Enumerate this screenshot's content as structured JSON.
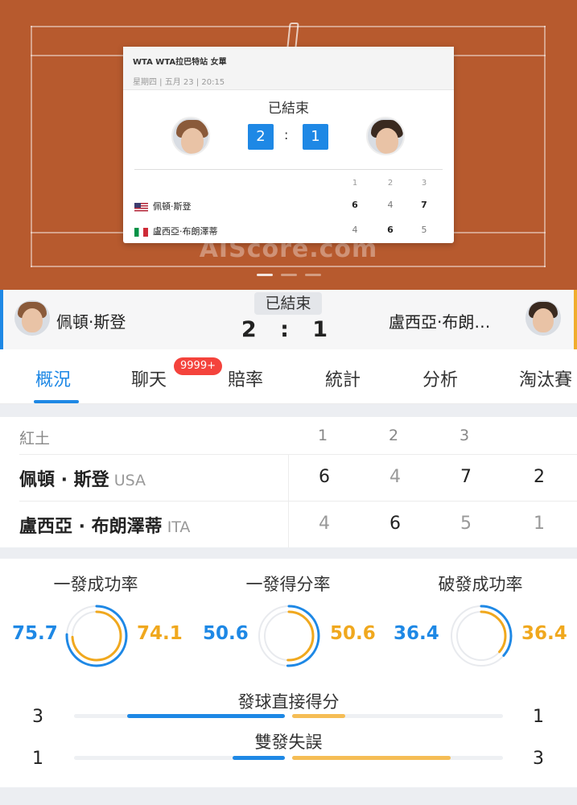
{
  "colors": {
    "accent": "#1e88e5",
    "player2": "#f0a81e",
    "court": "#b75a2e"
  },
  "header": {
    "watermark": "AIScore.com",
    "card": {
      "tournament": "WTA WTA拉巴特站 女單",
      "datetime": "星期四 | 五月 23 | 20:15",
      "status": "已結束",
      "score_home": "2",
      "score_away": "1",
      "colon": ":",
      "set_labels": [
        "1",
        "2",
        "3"
      ],
      "players": [
        {
          "name": "佩頓·斯登",
          "flag": "us-flag-icon",
          "sets": [
            "6",
            "4",
            "7"
          ]
        },
        {
          "name": "盧西亞·布朗澤蒂",
          "flag": "italy-flag-icon",
          "sets": [
            "4",
            "6",
            "5"
          ]
        }
      ]
    }
  },
  "match": {
    "home_name": "佩頓·斯登",
    "away_name": "盧西亞·布朗…",
    "status": "已結束",
    "score": "2 : 1"
  },
  "tabs": [
    {
      "label": "概況",
      "active": true
    },
    {
      "label": "聊天",
      "badge": "9999+"
    },
    {
      "label": "賠率"
    },
    {
      "label": "統計"
    },
    {
      "label": "分析"
    },
    {
      "label": "淘汰賽"
    }
  ],
  "scoretable": {
    "surface": "紅土",
    "set_headers": [
      "1",
      "2",
      "3"
    ],
    "rows": [
      {
        "name": "佩頓 · 斯登",
        "country": "USA",
        "sets": [
          "6",
          "4",
          "7"
        ],
        "total": "2"
      },
      {
        "name": "盧西亞 · 布朗澤蒂",
        "country": "ITA",
        "sets": [
          "4",
          "6",
          "5"
        ],
        "total": "1"
      }
    ]
  },
  "stats": {
    "donuts": [
      {
        "title": "一發成功率",
        "home": "75.7",
        "away": "74.1",
        "home_pct": 75.7,
        "away_pct": 74.1
      },
      {
        "title": "一發得分率",
        "home": "50.6",
        "away": "50.6",
        "home_pct": 50.6,
        "away_pct": 50.6
      },
      {
        "title": "破發成功率",
        "home": "36.4",
        "away": "36.4",
        "home_pct": 36.4,
        "away_pct": 36.4
      }
    ],
    "bars": [
      {
        "title": "發球直接得分",
        "home": "3",
        "away": "1",
        "home_frac": 0.75,
        "away_frac": 0.25
      },
      {
        "title": "雙發失誤",
        "home": "1",
        "away": "3",
        "home_frac": 0.25,
        "away_frac": 0.75
      }
    ]
  }
}
